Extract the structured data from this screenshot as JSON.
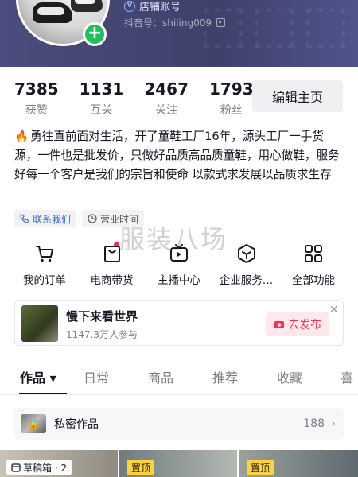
{
  "profile": {
    "store_label": "店铺账号",
    "douyin_id": "抖音号：shiling009"
  },
  "stats": [
    {
      "value": "7385",
      "label": "获赞"
    },
    {
      "value": "1131",
      "label": "互关"
    },
    {
      "value": "2467",
      "label": "关注"
    },
    {
      "value": "1793",
      "label": "粉丝"
    }
  ],
  "edit_button_label": "编辑主页",
  "bio": "勇往直前面对生活，开了童鞋工厂16年，源头工厂一手货源，一件也是批发价，只做好品质高品质童鞋，用心做鞋，服务好每一个客户是我们的宗旨和使命 以款式求发展以品质求生存",
  "tags": {
    "contact": "联系我们",
    "hours": "营业时间"
  },
  "features": [
    {
      "label": "我的订单",
      "icon": "cart-icon"
    },
    {
      "label": "电商带货",
      "icon": "shopping-bag-icon"
    },
    {
      "label": "主播中心",
      "icon": "live-tv-icon"
    },
    {
      "label": "企业服务…",
      "icon": "enterprise-icon"
    },
    {
      "label": "全部功能",
      "icon": "grid-apps-icon"
    }
  ],
  "watermark": "服装八场",
  "topic": {
    "title": "慢下来看世界",
    "participants": "1147.3万人参与",
    "publish_label": "去发布"
  },
  "tabs": [
    {
      "label": "作品 ▾",
      "active": true
    },
    {
      "label": "日常",
      "active": false
    },
    {
      "label": "商品",
      "active": false
    },
    {
      "label": "推荐",
      "active": false
    },
    {
      "label": "收藏",
      "active": false
    },
    {
      "label": "喜",
      "active": false
    }
  ],
  "private_works": {
    "label": "私密作品",
    "count": "188"
  },
  "thumbnails": {
    "draft_label": "草稿箱 · 2",
    "pin_label_1": "置顶",
    "pin_label_2": "置顶"
  },
  "colors": {
    "accent": "#fe2c55",
    "link": "#3a6fd8",
    "verified_green": "#20c15a"
  }
}
